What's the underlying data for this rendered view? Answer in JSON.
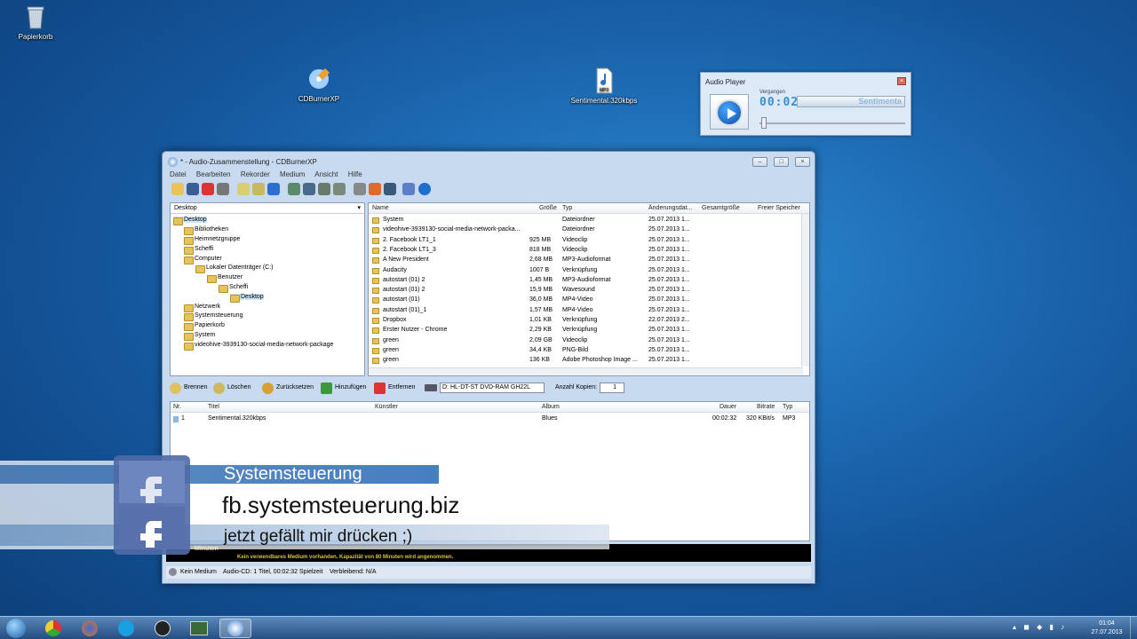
{
  "desktop": {
    "icons": [
      {
        "label": "Papierkorb",
        "icon": "recycle-bin-icon"
      },
      {
        "label": "CDBurnerXP",
        "icon": "cdburnerxp-icon"
      },
      {
        "label": "Sentimental.320kbps",
        "icon": "mp3-file-icon"
      }
    ]
  },
  "audio_player": {
    "title": "Audio Player",
    "close": "×",
    "elapsed_label": "Vergangen",
    "time": "00:02",
    "track": "Sentimenta"
  },
  "window": {
    "title": "* - Audio-Zusammenstellung - CDBurnerXP",
    "menu": [
      "Datei",
      "Bearbeiten",
      "Rekorder",
      "Medium",
      "Ansicht",
      "Hilfe"
    ],
    "location": "Desktop",
    "tree": [
      "Desktop",
      "Bibliotheken",
      "Heimnetzgruppe",
      "Scheffi",
      "Computer",
      "Lokaler Datenträger (C:)",
      "Benutzer",
      "Scheffi",
      "Desktop",
      "Netzwerk",
      "Systemsteuerung",
      "Papierkorb",
      "System",
      "videohive-3939130-social-media-network-package"
    ],
    "file_columns": [
      "Name",
      "Größe",
      "Typ",
      "Änderungsdat...",
      "Gesamtgröße",
      "Freier Speicher"
    ],
    "files": [
      {
        "name": "System",
        "size": "",
        "type": "Dateiordner",
        "date": "25.07.2013 1..."
      },
      {
        "name": "videohive-3939130-social-media-network-packa...",
        "size": "",
        "type": "Dateiordner",
        "date": "25.07.2013 1..."
      },
      {
        "name": "2. Facebook LT1_1",
        "size": "925 MB",
        "type": "Videoclip",
        "date": "25.07.2013 1..."
      },
      {
        "name": "2. Facebook LT1_3",
        "size": "818 MB",
        "type": "Videoclip",
        "date": "25.07.2013 1..."
      },
      {
        "name": "A New President",
        "size": "2,68 MB",
        "type": "MP3-Audioformat",
        "date": "25.07.2013 1..."
      },
      {
        "name": "Audacity",
        "size": "1007 B",
        "type": "Verknüpfung",
        "date": "25.07.2013 1..."
      },
      {
        "name": "autostart (01) 2",
        "size": "1,45 MB",
        "type": "MP3-Audioformat",
        "date": "25.07.2013 1..."
      },
      {
        "name": "autostart (01) 2",
        "size": "15,9 MB",
        "type": "Wavesound",
        "date": "25.07.2013 1..."
      },
      {
        "name": "autostart (01)",
        "size": "36,0 MB",
        "type": "MP4-Video",
        "date": "25.07.2013 1..."
      },
      {
        "name": "autostart (01)_1",
        "size": "1,57 MB",
        "type": "MP4-Video",
        "date": "25.07.2013 1..."
      },
      {
        "name": "Dropbox",
        "size": "1,01 KB",
        "type": "Verknüpfung",
        "date": "22.07.2013 2..."
      },
      {
        "name": "Erster Nutzer - Chrome",
        "size": "2,29 KB",
        "type": "Verknüpfung",
        "date": "25.07.2013 1..."
      },
      {
        "name": "green",
        "size": "2,09 GB",
        "type": "Videoclip",
        "date": "25.07.2013 1..."
      },
      {
        "name": "green",
        "size": "34,4 KB",
        "type": "PNG-Bild",
        "date": "25.07.2013 1..."
      },
      {
        "name": "green",
        "size": "136 KB",
        "type": "Adobe Photoshop Image ...",
        "date": "25.07.2013 1..."
      }
    ],
    "actions": {
      "burn": "Brennen",
      "delete": "Löschen",
      "reset": "Zurücksetzen",
      "add": "Hinzufügen",
      "remove": "Entfernen",
      "drive": "D: HL-DT-ST DVD-RAM GH22L",
      "copies_label": "Anzahl Kopien:",
      "copies": "1"
    },
    "compilation_columns": [
      "Nr.",
      "Titel",
      "Künstler",
      "Album",
      "Dauer",
      "Bitrate",
      "Typ"
    ],
    "compilation": [
      {
        "nr": "1",
        "title": "Sentimental.320kbps",
        "artist": "",
        "album": "Blues",
        "duration": "00:02:32",
        "bitrate": "320 KBit/s",
        "type": "MP3"
      }
    ],
    "capacity_label": "Minuten",
    "capacity_message": "Kein verwendbares Medium vorhanden. Kapazität von 80 Minuten wird angenommen.",
    "status": [
      "Kein Medium",
      "Audio-CD: 1 Titel, 00:02:32 Spielzeit",
      "Verbleibend: N/A"
    ]
  },
  "overlay": {
    "heading": "Systemsteuerung",
    "url": "fb.systemsteuerung.biz",
    "cta": "jetzt gefällt mir drücken ;)"
  },
  "taskbar": {
    "clock_time": "01:04",
    "clock_date": "27.07.2013"
  }
}
